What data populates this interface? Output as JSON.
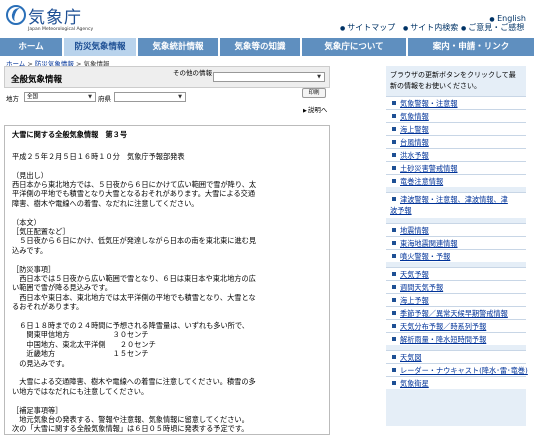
{
  "header": {
    "site_name": "気象庁",
    "site_sub": "Japan Meteorological Agency",
    "util": [
      "サイトマップ",
      "サイト内検索",
      "ご意見・ご感想"
    ],
    "lang": "English"
  },
  "nav": {
    "tabs": [
      "ホーム",
      "防災気象情報",
      "気象統計情報",
      "気象等の知識",
      "気象庁について",
      "案内・申請・リンク"
    ]
  },
  "breadcrumb": {
    "home": "ホーム",
    "sep": " > ",
    "section": "防災気象情報",
    "current": " > 気象情報"
  },
  "panel": {
    "title": "全般気象情報",
    "other_label": "その他の情報",
    "region_label": "地方",
    "region_value": "全国",
    "pref_label": "府県",
    "print_label": "印刷",
    "explain_label": "説明へ"
  },
  "bulletin": {
    "lines": [
      "大雪に関する全般気象情報　第３号",
      "",
      "平成２５年２月５日１６時１０分　気象庁予報部発表",
      "",
      "（見出し）",
      "西日本から東北地方では、５日夜から６日にかけて広い範囲で雪が降り、太",
      "平洋側の平地でも積雪となり大雪となるおそれがあります。大雪による交通",
      "障害、樹木や電線への着雪、なだれに注意してください。",
      "",
      "（本文）",
      "［気圧配置など］",
      "　５日夜から６日にかけ、低気圧が発達しながら日本の南を東北東に進む見",
      "込みです。",
      "",
      "［防災事項］",
      "　西日本では５日夜から広い範囲で雪となり、６日は東日本や東北地方の広",
      "い範囲で雪が降る見込みです。",
      "　西日本や東日本、東北地方では太平洋側の平地でも積雪となり、大雪とな",
      "るおそれがあります。",
      "",
      "　６日１８時までの２４時間に予想される降雪量は、いずれも多い所で、",
      "　　関東甲信地方　　　　　　３０センチ",
      "　　中国地方、東北太平洋側　　２０センチ",
      "　　近畿地方　　　　　　　　１５センチ",
      "　の見込みです。",
      "",
      "　大雪による交通障害、樹木や電線への着雪に注意してください。積雪の多",
      "い地方ではなだれにも注意してください。",
      "",
      "［補足事項等］",
      "　地元気象台の発表する、警報や注意報、気象情報に留意してください。",
      "次の「大雪に関する全般気象情報」は６日０５時頃に発表する予定です。"
    ]
  },
  "sidebar": {
    "intro": "ブラウザの更新ボタンをクリックして最新の情報をお使いください。",
    "group1": [
      "気象警報・注意報",
      "気象情報",
      "海上警報",
      "台風情報",
      "洪水予報",
      "土砂災害警戒情報",
      "竜巻注意情報"
    ],
    "group2": [
      "津波警報・注意報、津波情報、津波予報"
    ],
    "group3": [
      "地震情報",
      "東海地震関連情報",
      "噴火警報・予報"
    ],
    "group4": [
      "天気予報",
      "週間天気予報",
      "海上予報",
      "季節予報／異常天候早期警戒情報",
      "天気分布予報／時系列予報",
      "解析雨量・降水短時間予報"
    ],
    "group5": [
      "天気図",
      "レーダー・ナウキャスト(降水･雷･竜巻)",
      "気象衛星"
    ]
  },
  "colors": {
    "nav": "#5f8fbf",
    "nav_active": "#b9d3ec",
    "link": "#003399",
    "sidebar_bg": "#e5eef7"
  }
}
